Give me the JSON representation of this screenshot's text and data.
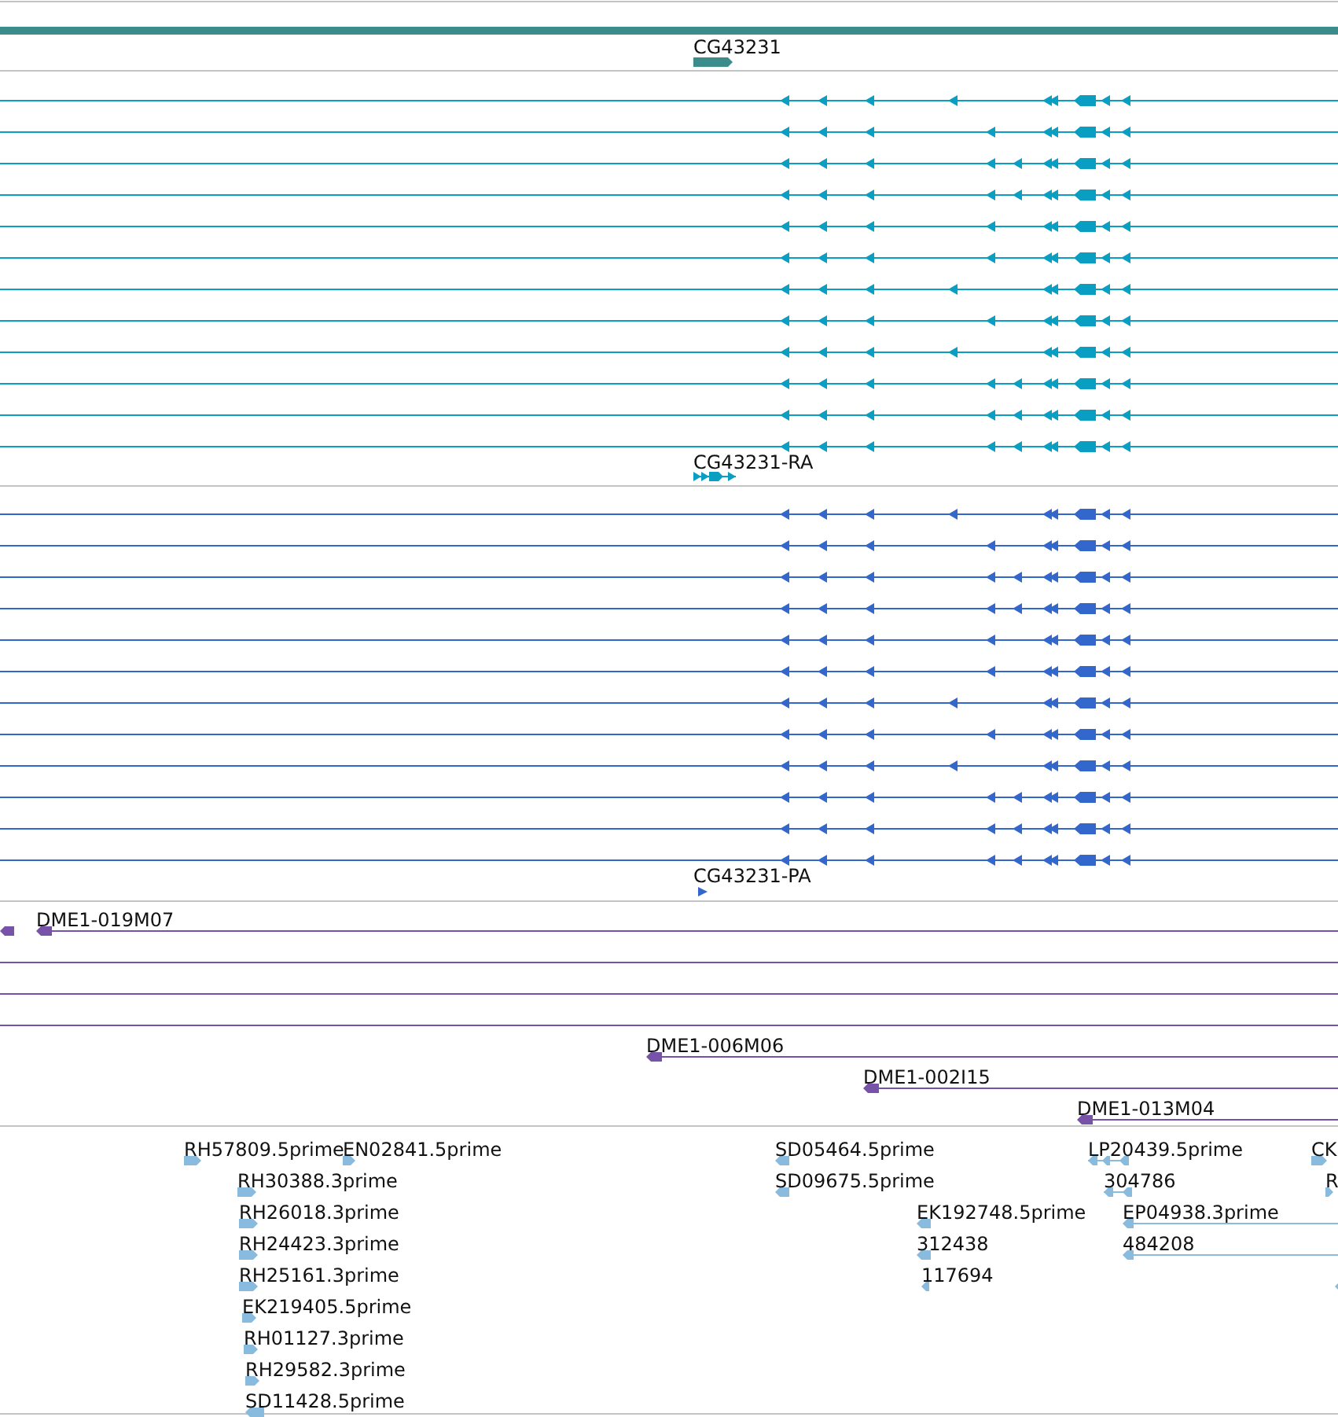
{
  "gene": {
    "label": "CG43231",
    "color": "#3d8c8c"
  },
  "tracks": [
    {
      "kind": "transcripts",
      "color": "#0a9fc2",
      "label": "CG43231-RA",
      "transcripts": [
        {
          "kind": "upstream"
        },
        {
          "kind": "middle"
        },
        {
          "kind": "split"
        },
        {
          "kind": "split"
        },
        {
          "kind": "middle"
        },
        {
          "kind": "middle"
        },
        {
          "kind": "upstream"
        },
        {
          "kind": "middle"
        },
        {
          "kind": "upstream"
        },
        {
          "kind": "split"
        },
        {
          "kind": "split"
        },
        {
          "kind": "split"
        }
      ]
    },
    {
      "kind": "transcripts",
      "color": "#3367cc",
      "label": "CG43231-PA",
      "transcripts": [
        {
          "kind": "upstream"
        },
        {
          "kind": "middle"
        },
        {
          "kind": "split"
        },
        {
          "kind": "split"
        },
        {
          "kind": "middle"
        },
        {
          "kind": "middle"
        },
        {
          "kind": "upstream"
        },
        {
          "kind": "middle"
        },
        {
          "kind": "upstream"
        },
        {
          "kind": "split"
        },
        {
          "kind": "split"
        },
        {
          "kind": "split"
        }
      ]
    },
    {
      "kind": "clones",
      "color": "#7653a8",
      "clones": [
        {
          "kind": "starting",
          "label": "DME1-019M07"
        },
        {
          "kind": "spanning"
        },
        {
          "kind": "spanning"
        },
        {
          "kind": "spanning"
        },
        {
          "kind": "starting",
          "label": "DME1-006M06"
        },
        {
          "kind": "starting",
          "label": "DME1-002I15"
        },
        {
          "kind": "starting",
          "label": "DME1-013M04"
        }
      ]
    },
    {
      "kind": "reads",
      "color": "#88bbdd",
      "reads": [
        {
          "kind": "forward",
          "label": "RH57809.5prime"
        },
        {
          "kind": "forward",
          "label": "EN02841.5prime"
        },
        {
          "kind": "forward",
          "label": "RH30388.3prime"
        },
        {
          "kind": "forward",
          "label": "RH26018.3prime"
        },
        {
          "kind": "forward",
          "label": "RH24423.3prime"
        },
        {
          "kind": "forward",
          "label": "RH25161.3prime"
        },
        {
          "kind": "forward",
          "label": "EK219405.5prime"
        },
        {
          "kind": "forward",
          "label": "RH01127.3prime"
        },
        {
          "kind": "forward",
          "label": "RH29582.3prime"
        },
        {
          "kind": "reverse",
          "label": "SD11428.5prime"
        },
        {
          "kind": "reverse",
          "label": "SD05464.5prime"
        },
        {
          "kind": "reverse",
          "label": "SD09675.5prime"
        },
        {
          "kind": "reverse",
          "label": "EK192748.5prime"
        },
        {
          "kind": "reverse",
          "label": "312438"
        },
        {
          "kind": "reverse",
          "label": "117694"
        },
        {
          "kind": "spliced",
          "label": "LP20439.5prime"
        },
        {
          "kind": "spliced",
          "label": "304786"
        },
        {
          "kind": "long",
          "label": "EP04938.3prime"
        },
        {
          "kind": "long",
          "label": "484208"
        },
        {
          "kind": "forward",
          "label": "CK"
        },
        {
          "kind": "forward",
          "label": "R"
        },
        {
          "kind": "reverse"
        }
      ]
    }
  ]
}
